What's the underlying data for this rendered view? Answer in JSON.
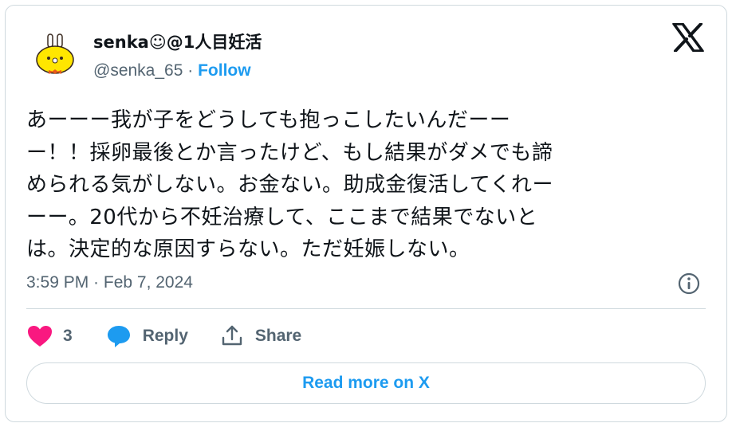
{
  "author": {
    "display_name": "senka☺︎@1人目妊活",
    "handle": "@senka_65",
    "separator": "·",
    "follow_label": "Follow"
  },
  "tweet": {
    "lines": [
      "あーーー我が子をどうしても抱っこしたいんだーー",
      "ー！！採卵最後とか言ったけど、もし結果がダメでも諦",
      "められる気がしない。お金ない。助成金復活してくれー",
      "ーー。20代から不妊治療して、ここまで結果でないと",
      "は。決定的な原因すらない。ただ妊娠しない。"
    ],
    "timestamp": "3:59 PM · Feb 7, 2024"
  },
  "actions": {
    "like_count": "3",
    "reply_label": "Reply",
    "share_label": "Share"
  },
  "read_more_label": "Read more on X",
  "colors": {
    "accent": "#1d9bf0",
    "like": "#f91880",
    "secondary_text": "#536471",
    "border": "#cfd9de"
  },
  "icons": [
    "avatar",
    "x-logo-icon",
    "info-icon",
    "heart-icon",
    "reply-bubble-icon",
    "share-icon"
  ]
}
